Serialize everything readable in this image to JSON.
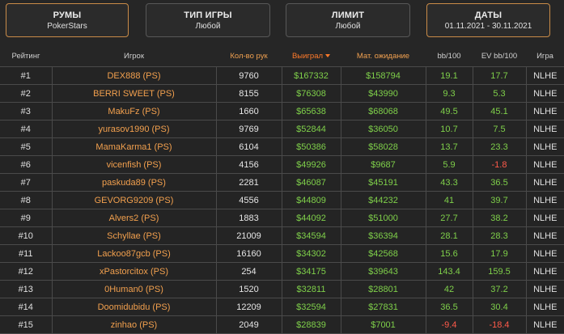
{
  "filters": [
    {
      "title": "РУМЫ",
      "value": "PokerStars"
    },
    {
      "title": "ТИП ИГРЫ",
      "value": "Любой"
    },
    {
      "title": "ЛИМИТ",
      "value": "Любой"
    },
    {
      "title": "ДАТЫ",
      "value": "01.11.2021 - 30.11.2021"
    }
  ],
  "table": {
    "headers": {
      "rank": "Рейтинг",
      "player": "Игрок",
      "hands": "Кол-во рук",
      "won": "Выиграл",
      "ev": "Мат. ожидание",
      "bb100": "bb/100",
      "evbb100": "EV bb/100",
      "game": "Игра"
    },
    "sorted_by": "won",
    "rows": [
      {
        "rank": "#1",
        "player": "DEX888 (PS)",
        "hands": "9760",
        "won": "$167332",
        "ev": "$158794",
        "bb100": "19.1",
        "evbb100": "17.7",
        "game": "NLHE"
      },
      {
        "rank": "#2",
        "player": "BERRI SWEET (PS)",
        "hands": "8155",
        "won": "$76308",
        "ev": "$43990",
        "bb100": "9.3",
        "evbb100": "5.3",
        "game": "NLHE"
      },
      {
        "rank": "#3",
        "player": "MakuFz (PS)",
        "hands": "1660",
        "won": "$65638",
        "ev": "$68068",
        "bb100": "49.5",
        "evbb100": "45.1",
        "game": "NLHE"
      },
      {
        "rank": "#4",
        "player": "yurasov1990 (PS)",
        "hands": "9769",
        "won": "$52844",
        "ev": "$36050",
        "bb100": "10.7",
        "evbb100": "7.5",
        "game": "NLHE"
      },
      {
        "rank": "#5",
        "player": "MamaKarma1 (PS)",
        "hands": "6104",
        "won": "$50386",
        "ev": "$58028",
        "bb100": "13.7",
        "evbb100": "23.3",
        "game": "NLHE"
      },
      {
        "rank": "#6",
        "player": "vicenfish (PS)",
        "hands": "4156",
        "won": "$49926",
        "ev": "$9687",
        "bb100": "5.9",
        "evbb100": "-1.8",
        "game": "NLHE"
      },
      {
        "rank": "#7",
        "player": "paskuda89 (PS)",
        "hands": "2281",
        "won": "$46087",
        "ev": "$45191",
        "bb100": "43.3",
        "evbb100": "36.5",
        "game": "NLHE"
      },
      {
        "rank": "#8",
        "player": "GEVORG9209 (PS)",
        "hands": "4556",
        "won": "$44809",
        "ev": "$44232",
        "bb100": "41",
        "evbb100": "39.7",
        "game": "NLHE"
      },
      {
        "rank": "#9",
        "player": "Alvers2 (PS)",
        "hands": "1883",
        "won": "$44092",
        "ev": "$51000",
        "bb100": "27.7",
        "evbb100": "38.2",
        "game": "NLHE"
      },
      {
        "rank": "#10",
        "player": "Schyllae (PS)",
        "hands": "21009",
        "won": "$34594",
        "ev": "$36394",
        "bb100": "28.1",
        "evbb100": "28.3",
        "game": "NLHE"
      },
      {
        "rank": "#11",
        "player": "Lackoo87gcb (PS)",
        "hands": "16160",
        "won": "$34302",
        "ev": "$42568",
        "bb100": "15.6",
        "evbb100": "17.9",
        "game": "NLHE"
      },
      {
        "rank": "#12",
        "player": "xPastorcitox (PS)",
        "hands": "254",
        "won": "$34175",
        "ev": "$39643",
        "bb100": "143.4",
        "evbb100": "159.5",
        "game": "NLHE"
      },
      {
        "rank": "#13",
        "player": "0Human0 (PS)",
        "hands": "1520",
        "won": "$32811",
        "ev": "$28801",
        "bb100": "42",
        "evbb100": "37.2",
        "game": "NLHE"
      },
      {
        "rank": "#14",
        "player": "Doomidubidu (PS)",
        "hands": "12209",
        "won": "$32594",
        "ev": "$27831",
        "bb100": "36.5",
        "evbb100": "30.4",
        "game": "NLHE"
      },
      {
        "rank": "#15",
        "player": "zinhao (PS)",
        "hands": "2049",
        "won": "$28839",
        "ev": "$7001",
        "bb100": "-9.4",
        "evbb100": "-18.4",
        "game": "NLHE"
      }
    ]
  }
}
